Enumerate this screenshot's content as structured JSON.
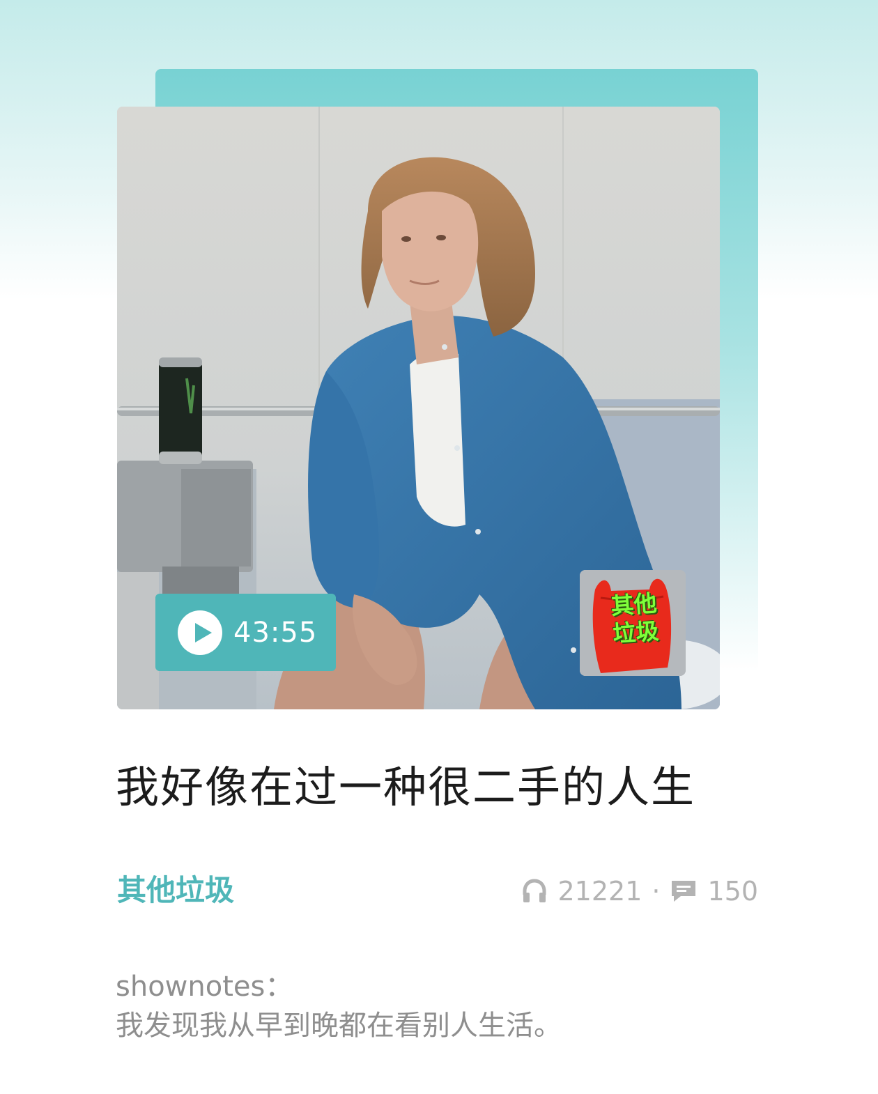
{
  "episode": {
    "duration": "43:55",
    "title": "我好像在过一种很二手的人生",
    "podcast_name": "其他垃圾",
    "podcast_logo_text": "其他\n垃圾",
    "plays": "21221",
    "separator": "·",
    "comments": "150"
  },
  "shownotes": {
    "heading": "shownotes：",
    "body": "我发现我从早到晚都在看别人生活。"
  },
  "icons": {
    "play": "play-icon",
    "plays": "headphones-icon",
    "comments": "comment-icon"
  },
  "colors": {
    "accent": "#4fb6b8",
    "muted": "#b3b3b3"
  }
}
